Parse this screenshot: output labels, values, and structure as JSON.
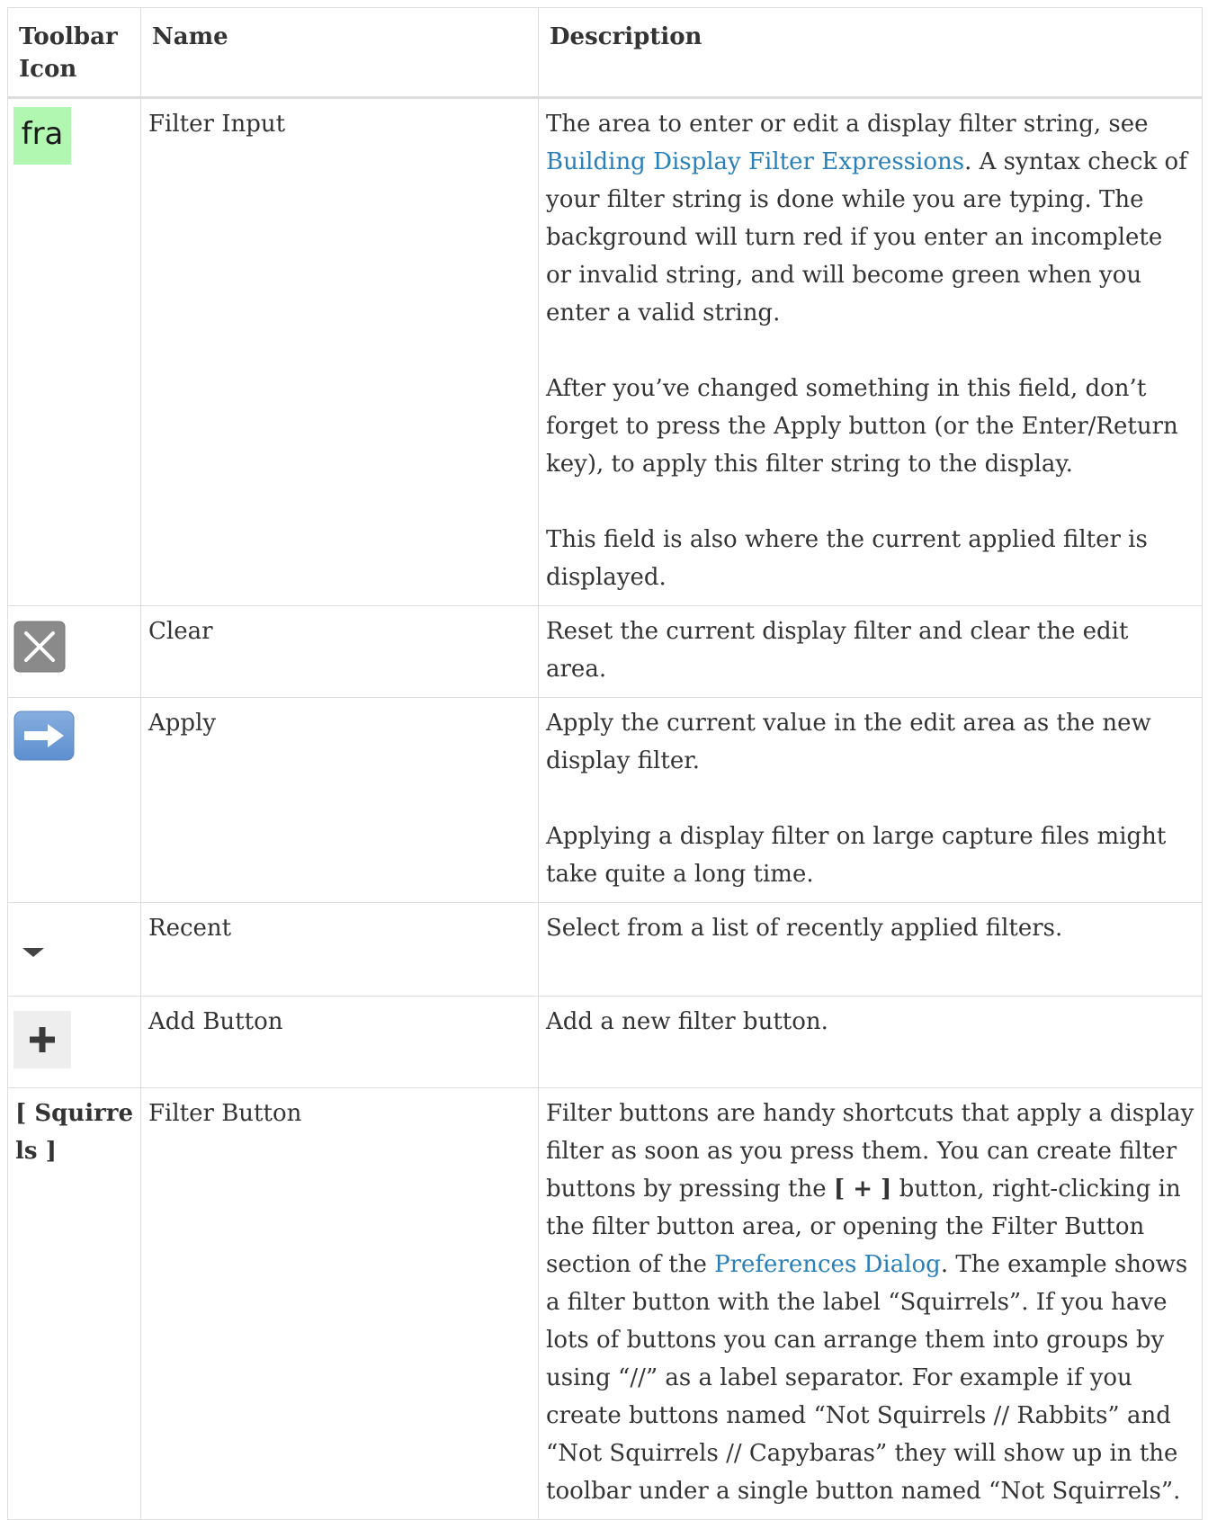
{
  "headers": {
    "icon": "Toolbar Icon",
    "name": "Name",
    "description": "Description"
  },
  "rows": [
    {
      "icon": "fra",
      "icon_name": "filter-input-icon",
      "name": "Filter Input",
      "desc": {
        "p1_before": "The area to enter or edit a display filter string, see ",
        "p1_link": "Building Display Filter Expressions",
        "p1_after": ". A syntax check of your filter string is done while you are typing. The background will turn red if you enter an incomplete or invalid string, and will become green when you enter a valid string.",
        "p2": "After you’ve changed something in this field, don’t forget to press the Apply button (or the Enter/Return key), to apply this filter string to the display.",
        "p3": "This field is also where the current applied filter is displayed."
      }
    },
    {
      "icon_name": "clear-icon",
      "name": "Clear",
      "desc": {
        "p1": "Reset the current display filter and clear the edit area."
      }
    },
    {
      "icon_name": "apply-arrow-icon",
      "name": "Apply",
      "desc": {
        "p1": "Apply the current value in the edit area as the new display filter.",
        "p2": "Applying a display filter on large capture files might take quite a long time."
      }
    },
    {
      "icon_name": "recent-dropdown-icon",
      "name": "Recent",
      "desc": {
        "p1": "Select from a list of recently applied filters."
      }
    },
    {
      "icon_name": "add-plus-icon",
      "name": "Add Button",
      "desc": {
        "p1": "Add a new filter button."
      }
    },
    {
      "icon": "[ Squirrels ]",
      "name": "Filter Button",
      "desc": {
        "p1_a": "Filter buttons are handy shortcuts that apply a display filter as soon as you press them. You can create filter buttons by pressing the ",
        "p1_bold": "[ + ]",
        "p1_b": " button, right-clicking in the filter button area, or opening the Filter Button section of the ",
        "p1_link": "Preferences Dialog",
        "p1_c": ". The example shows a filter button with the label “Squirrels”. If you have lots of buttons you can arrange them into groups by using “//” as a label separator. For example if you create buttons named “Not Squirrels // Rabbits” and “Not Squirrels // Capybaras” they will show up in the toolbar under a single button named “Not Squirrels”."
      }
    }
  ],
  "colors": {
    "link": "#2980b9",
    "filter_icon_bg": "#b1f7b1",
    "border": "#dedede"
  }
}
